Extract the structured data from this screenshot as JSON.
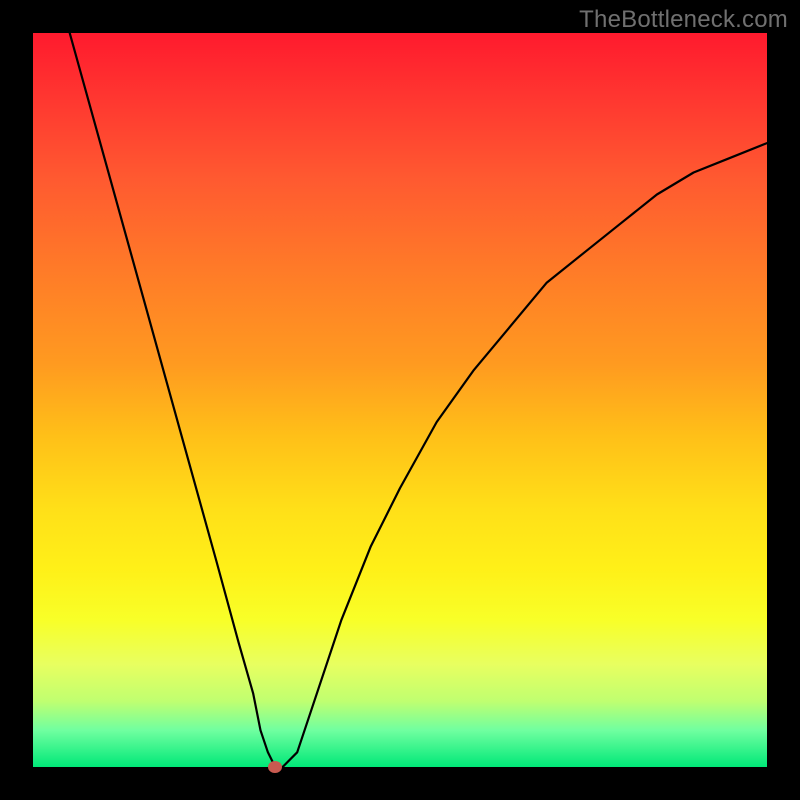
{
  "watermark_text": "TheBottleneck.com",
  "chart_data": {
    "type": "line",
    "title": "",
    "xlabel": "",
    "ylabel": "",
    "xlim": [
      0,
      100
    ],
    "ylim": [
      0,
      100
    ],
    "grid": false,
    "legend": false,
    "background": "rainbow-gradient (red→yellow→green top→bottom)",
    "marker": {
      "x": 33,
      "y": 0,
      "color": "#c85a50"
    },
    "series": [
      {
        "name": "curve",
        "color": "#000000",
        "x": [
          5,
          10,
          15,
          20,
          25,
          28,
          30,
          31,
          32,
          33,
          34,
          36,
          38,
          42,
          46,
          50,
          55,
          60,
          65,
          70,
          75,
          80,
          85,
          90,
          95,
          100
        ],
        "values": [
          100,
          82,
          64,
          46,
          28,
          17,
          10,
          5,
          2,
          0,
          0,
          2,
          8,
          20,
          30,
          38,
          47,
          54,
          60,
          66,
          70,
          74,
          78,
          81,
          83,
          85
        ]
      }
    ],
    "notes": "V-shaped bottleneck curve with minimum near x=33; background heat gradient (red=high bottleneck at top, green=low at bottom)."
  },
  "colors": {
    "frame": "#000000",
    "curve_stroke": "#000000",
    "marker": "#c85a50",
    "watermark": "#707070"
  }
}
